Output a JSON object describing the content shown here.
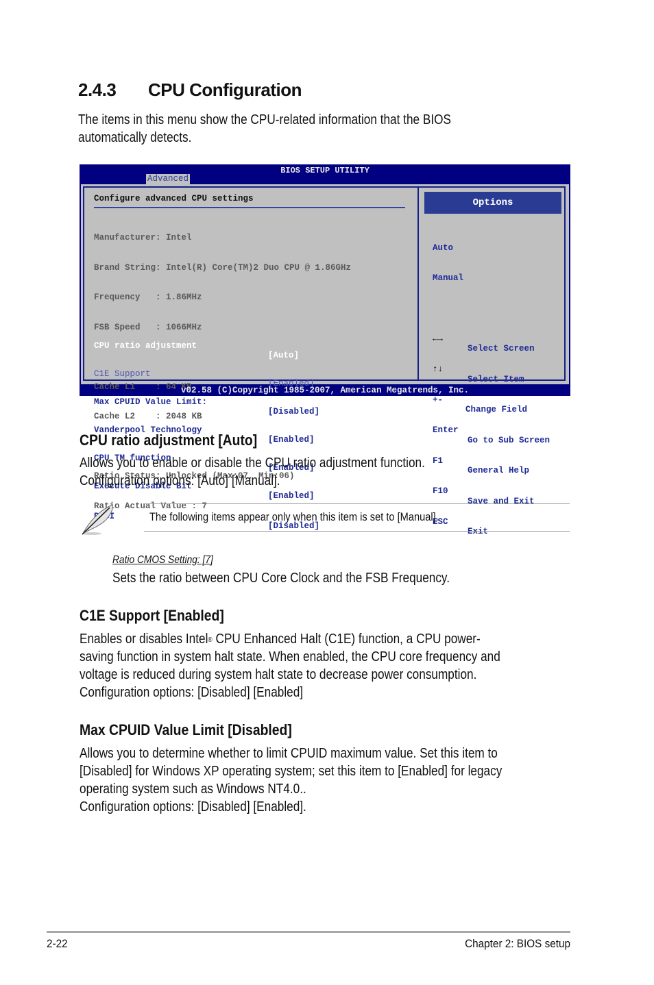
{
  "section": {
    "number": "2.4.3",
    "title": "CPU Configuration",
    "intro_line1": "The items in this menu show the CPU-related information that the BIOS",
    "intro_line2": "automatically detects."
  },
  "bios": {
    "title": "BIOS SETUP UTILITY",
    "active_tab": "Advanced",
    "heading": "Configure advanced CPU settings",
    "info": [
      "Manufacturer: Intel",
      "Brand String: Intel(R) Core(TM)2 Duo CPU @ 1.86GHz",
      "Frequency   : 1.86MHz",
      "FSB Speed   : 1066MHz",
      "",
      "Cache L1    : 64 KB",
      "Cache L2    : 2048 KB",
      "",
      "Ratio Status: Unlocked (Max:07, Min:06)",
      "Ratio Actual Value : 7"
    ],
    "items": [
      {
        "label": "CPU ratio adjustment",
        "value": "[Auto]",
        "state": "selected"
      },
      {
        "label": "C1E Support",
        "value": "[Enabled]",
        "state": "dim"
      },
      {
        "label": "Max CPUID Value Limit:",
        "value": "[Disabled]",
        "state": "normal"
      },
      {
        "label": "Vanderpool Technology",
        "value": "[Enabled]",
        "state": "normal"
      },
      {
        "label": "CPU TM function",
        "value": "[Enabled]",
        "state": "normal"
      },
      {
        "label": "Execute Disable Bit",
        "value": "[Enabled]",
        "state": "normal"
      },
      {
        "label": "PECI",
        "value": "[Disabled]",
        "state": "normal"
      }
    ],
    "options_header": "Options",
    "options": [
      "Auto",
      "Manual"
    ],
    "keys": [
      {
        "key": "←→",
        "icon": "left-right-arrows-icon",
        "desc": "Select Screen"
      },
      {
        "key": "↑↓",
        "icon": "up-down-arrows-icon",
        "desc": "Select Item"
      },
      {
        "key": "+-",
        "icon": "",
        "desc": "Change Field"
      },
      {
        "key": "Enter",
        "icon": "",
        "desc": "Go to Sub Screen"
      },
      {
        "key": "F1",
        "icon": "",
        "desc": "General Help"
      },
      {
        "key": "F10",
        "icon": "",
        "desc": "Save and Exit"
      },
      {
        "key": "ESC",
        "icon": "",
        "desc": "Exit"
      }
    ],
    "footer": "v02.58 (C)Copyright 1985-2007, American Megatrends, Inc.",
    "colors": {
      "frame": "#000080",
      "panel": "#c0c0c0",
      "options_header": "#2a3b94",
      "item_text": "#1e2a96"
    }
  },
  "cpu_ratio": {
    "heading": "CPU ratio adjustment [Auto]",
    "line1": "Allows you to enable or disable the CPU ratio adjustment function.",
    "line2": "Configuration options: [Auto] [Manual]."
  },
  "note": {
    "icon": "feather-pen-icon",
    "text": "The following items appear only when this item is set to [Manual]."
  },
  "ratio_cmos": {
    "label": "Ratio CMOS Setting: [7]",
    "text": "Sets the ratio between CPU Core Clock and the FSB Frequency."
  },
  "c1e": {
    "heading": "C1E Support [Enabled]",
    "line1_pre": "Enables or disables Intel",
    "line1_sup": "®",
    "line1_post": " CPU Enhanced Halt (C1E) function, a CPU power-",
    "line2": "saving function in system halt state. When enabled, the CPU core frequency and",
    "line3": "voltage is reduced during system halt state to decrease power consumption.",
    "line4": "Configuration options: [Disabled] [Enabled]"
  },
  "cpuid": {
    "heading": "Max CPUID Value Limit [Disabled]",
    "line1": "Allows you to determine whether to limit CPUID maximum value. Set this item to",
    "line2": "[Disabled] for Windows XP operating system; set this item to [Enabled] for legacy",
    "line3": "operating system such as Windows  NT4.0..",
    "line4": "Configuration options: [Disabled] [Enabled]."
  },
  "page_footer": {
    "page_number": "2-22",
    "chapter": "Chapter 2: BIOS setup"
  }
}
